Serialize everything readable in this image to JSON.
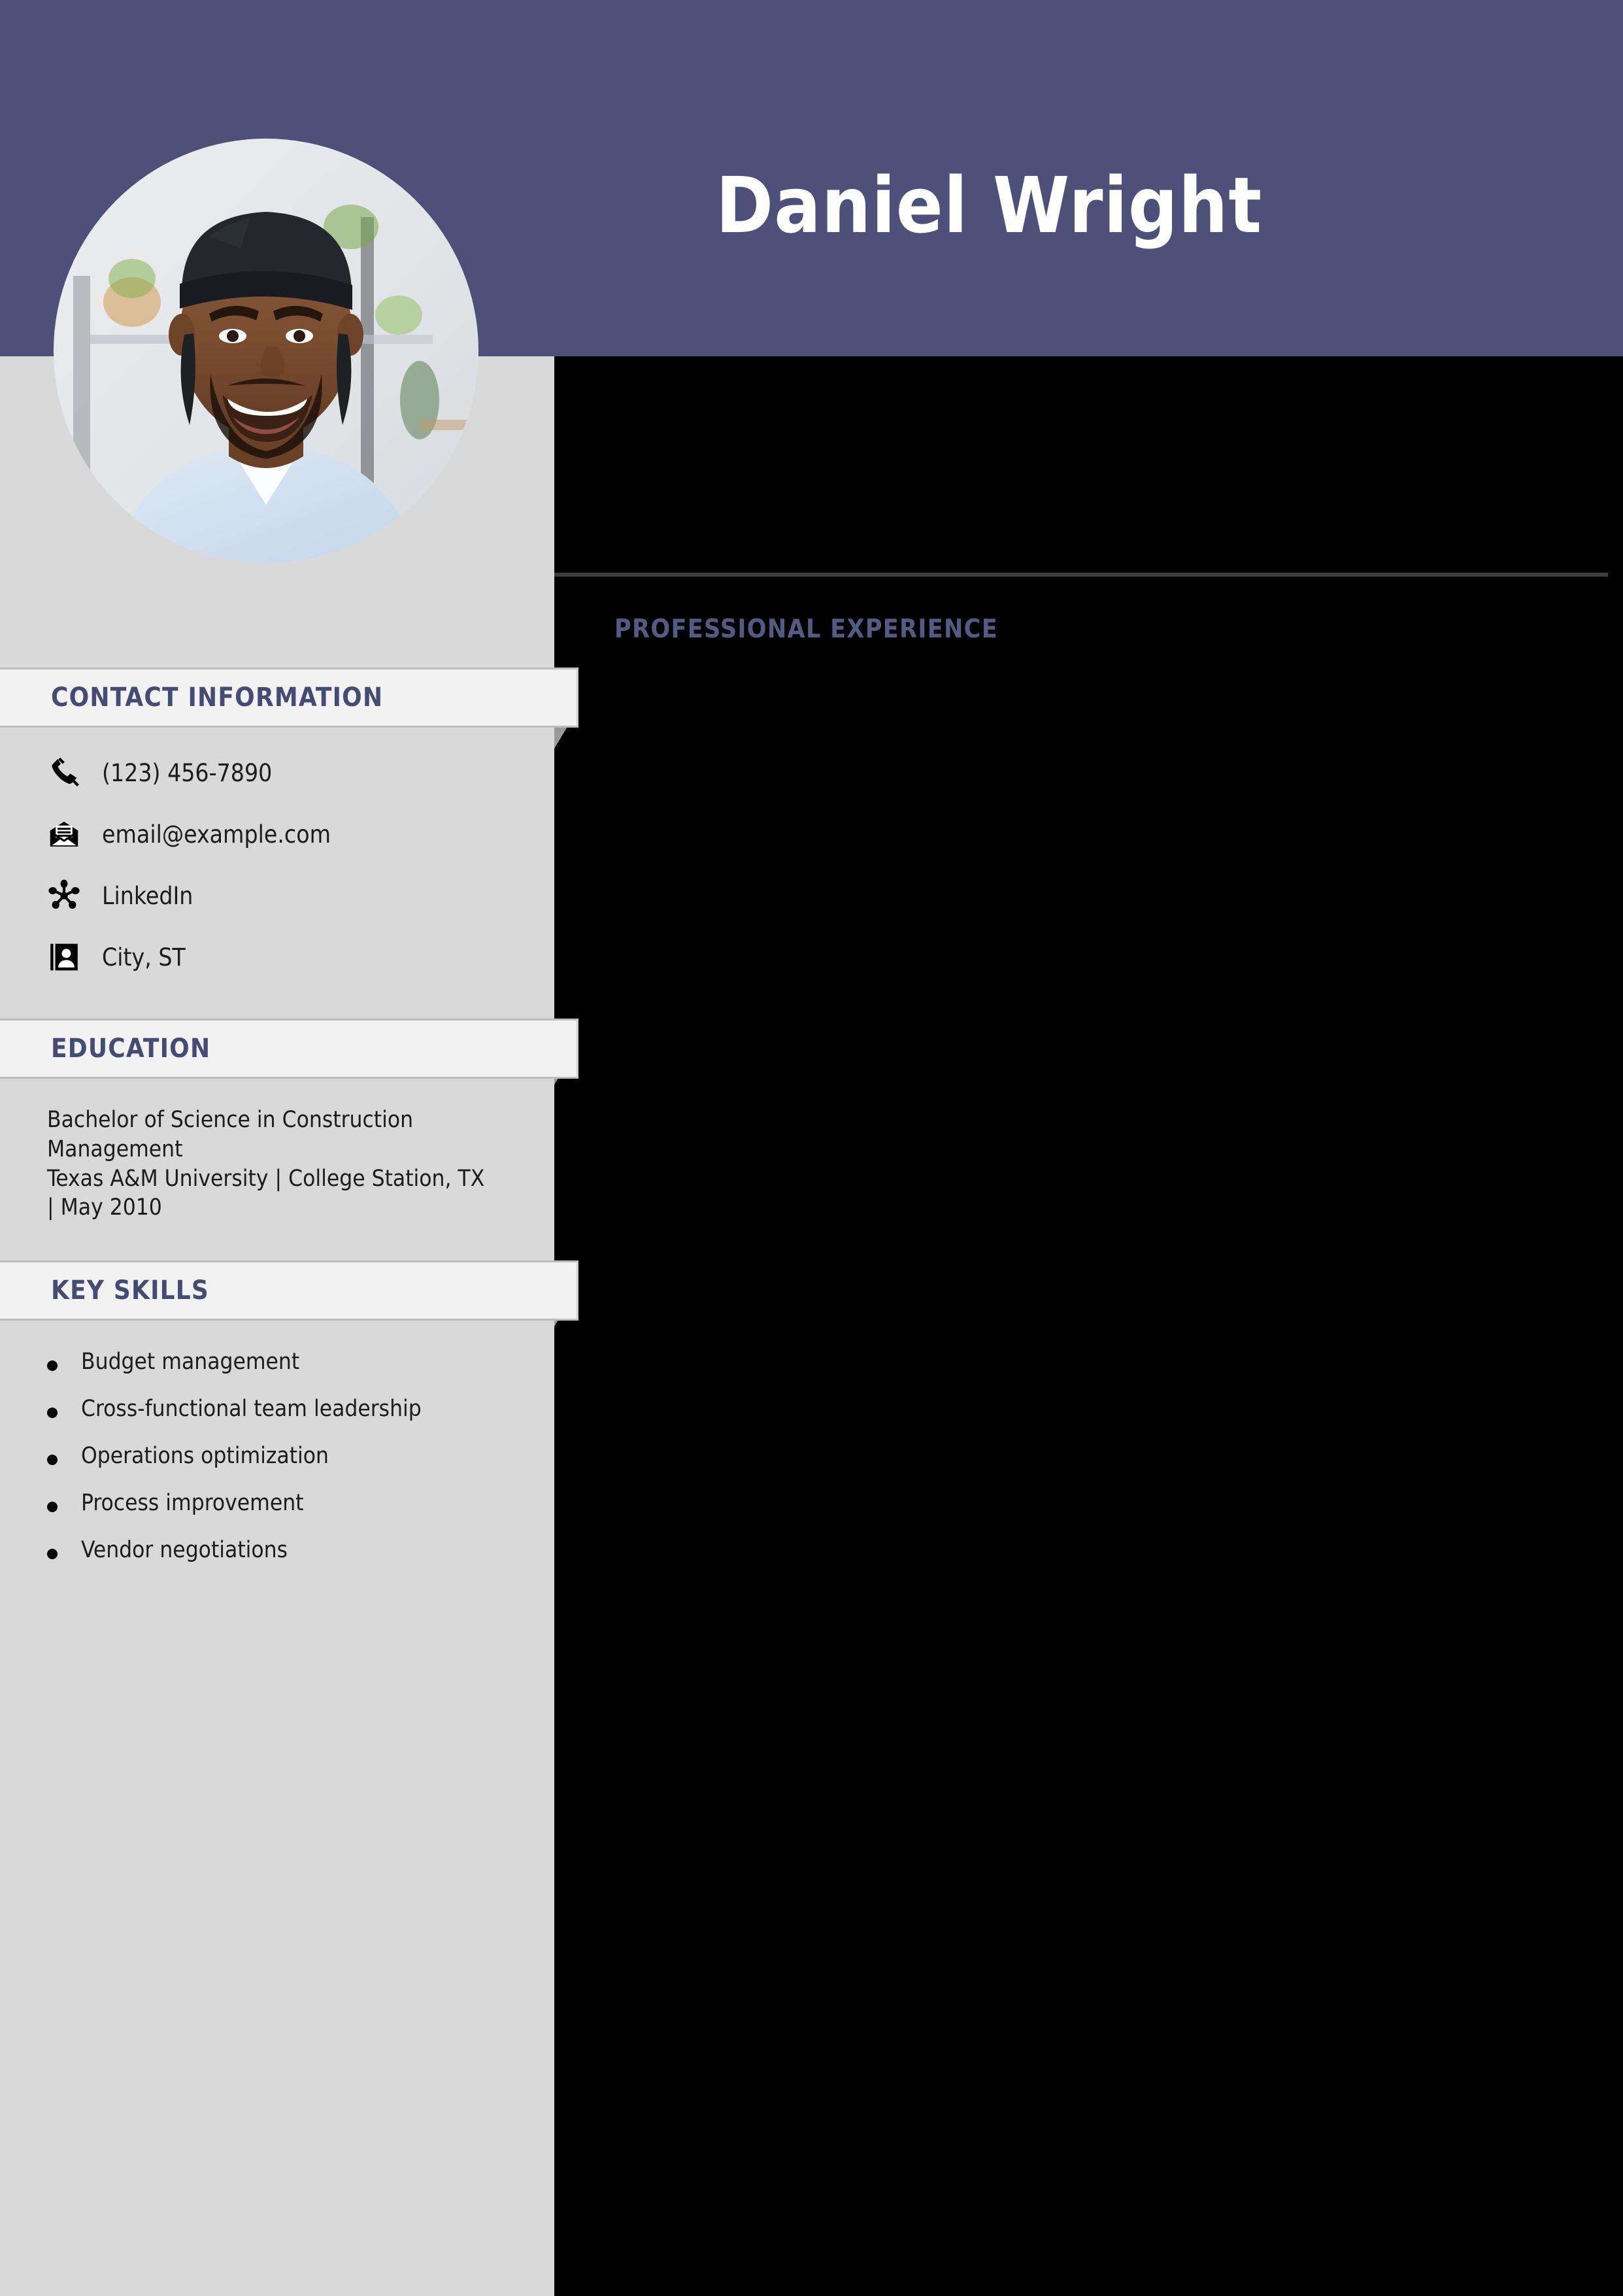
{
  "theme": {
    "header_blue": "#4d5179",
    "sidebar_gray": "#d9d9d9",
    "banner_light": "#f2f2f2",
    "section_title_blue": "#464b73",
    "main_background": "#000000",
    "main_section_title_blue": "#545a84",
    "body_text": "#1c1c1c"
  },
  "header": {
    "full_name": "Daniel Wright"
  },
  "sidebar": {
    "sections": [
      {
        "key": "contact",
        "title": "CONTACT INFORMATION"
      },
      {
        "key": "education",
        "title": "EDUCATION"
      },
      {
        "key": "skills",
        "title": "KEY SKILLS"
      }
    ],
    "contact": {
      "title": "CONTACT INFORMATION",
      "items": [
        {
          "icon": "phone-icon",
          "value": "(123) 456-7890"
        },
        {
          "icon": "envelope-icon",
          "value": "email@example.com"
        },
        {
          "icon": "network-hub-icon",
          "value": "LinkedIn"
        },
        {
          "icon": "contact-card-icon",
          "value": "City, ST"
        }
      ]
    },
    "education": {
      "title": "EDUCATION",
      "lines": [
        "Bachelor of Science in Construction",
        "Management",
        "Texas A&M University | College Station, TX",
        "| May 2010"
      ]
    },
    "skills": {
      "title": "KEY SKILLS",
      "items": [
        "Budget management",
        "Cross-functional team leadership",
        "Operations optimization",
        "Process improvement",
        "Vendor negotiations"
      ]
    }
  },
  "main": {
    "sections": [
      {
        "title": "PROFESSIONAL EXPERIENCE",
        "entries": []
      }
    ],
    "professional_experience_title": "PROFESSIONAL EXPERIENCE"
  }
}
